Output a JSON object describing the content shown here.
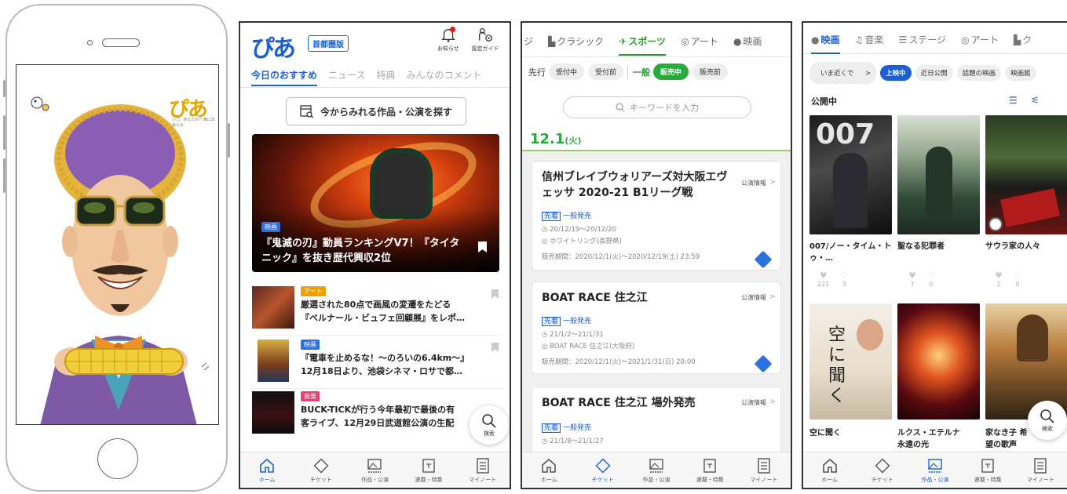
{
  "splash": {
    "logo": "ぴあ",
    "tagline": "いつ、あなたの一番に出会える"
  },
  "tabbar": {
    "items": [
      {
        "label": "ホーム",
        "icon": "home-icon"
      },
      {
        "label": "チケット",
        "icon": "ticket-icon"
      },
      {
        "label": "作品・公演",
        "icon": "works-icon"
      },
      {
        "label": "連載・特集",
        "icon": "feature-icon"
      },
      {
        "label": "マイノート",
        "icon": "notebook-icon"
      }
    ]
  },
  "home": {
    "logo": "ぴあ",
    "region": "首都圏版",
    "notice_label": "お知らせ",
    "settings_label": "設定ガイド",
    "tabs": [
      "今日のおすすめ",
      "ニュース",
      "特典",
      "みんなのコメント"
    ],
    "find_button": "今からみれる作品・公演を探す",
    "hero": {
      "category": "映画",
      "title": "『鬼滅の刃』動員ランキングV7！『タイタニック』を抜き歴代興収2位"
    },
    "news": [
      {
        "category": "アート",
        "line1": "厳選された80点で画風の変遷をたどる",
        "line2": "『ベルナール・ビュフェ回顧展』をレポ…"
      },
      {
        "category": "映画",
        "line1": "『電車を止めるな！～のろいの6.4km～』",
        "line2": "12月18日より、池袋シネマ・ロサで都…"
      },
      {
        "category": "音楽",
        "line1": "BUCK-TICKが行う今年最初で最後の有",
        "line2": "客ライブ、12月29日武道館公演の生配"
      }
    ],
    "search_label": "検索"
  },
  "tickets": {
    "categories": [
      "ジ",
      "クラシック",
      "スポーツ",
      "アート",
      "映画"
    ],
    "active_category": "スポーツ",
    "filter_group1_label": "先行",
    "filter_group1": [
      "受付中",
      "受付前"
    ],
    "filter_group2_label": "一般",
    "filter_group2": [
      "販売中",
      "販売前"
    ],
    "keyword_placeholder": "キーワードを入力",
    "date": "12.1",
    "weekday": "(火)",
    "events": [
      {
        "title": "信州ブレイブウォリアーズ対大阪エヴェッサ 2020-21 B1リーグ戦",
        "info": "公演情報",
        "tag": "先着",
        "sale": "一般発売",
        "dates": "20/12/19～20/12/20",
        "venue": "ホワイトリング(長野県)",
        "period": "販売期間：2020/12/1(火)～2020/12/19(土) 23:59"
      },
      {
        "title": "BOAT RACE 住之江",
        "info": "公演情報",
        "tag": "先着",
        "sale": "一般発売",
        "dates": "21/1/2～21/1/31",
        "venue": "BOAT RACE 住之江(大阪府)",
        "period": "販売期間：2020/12/1(火)～2021/1/31(日) 20:00"
      },
      {
        "title": "BOAT RACE 住之江 場外発売",
        "info": "公演情報",
        "tag": "先着",
        "sale": "一般発売",
        "dates": "21/1/8～21/1/27"
      }
    ]
  },
  "movies": {
    "categories": [
      "映画",
      "音楽",
      "ステージ",
      "アート",
      "ク"
    ],
    "pills": [
      "いま近くで",
      "上映中",
      "近日公開",
      "話題の映画",
      "映画館"
    ],
    "section": "公開中",
    "films": [
      {
        "title": "007/ノー・タイム・トゥ・…",
        "likes": "221",
        "watched": "3"
      },
      {
        "title": "聖なる犯罪者",
        "likes": "7",
        "watched": "0"
      },
      {
        "title": "サウラ家の人々",
        "likes": "2",
        "watched": "0"
      },
      {
        "title": "空に聞く",
        "likes": "",
        "watched": ""
      },
      {
        "title": "ルクス・エテルナ 永遠の光",
        "likes": "",
        "watched": ""
      },
      {
        "title": "家なき子 希望の歌声",
        "likes": "",
        "watched": ""
      }
    ],
    "search_label": "検索"
  }
}
